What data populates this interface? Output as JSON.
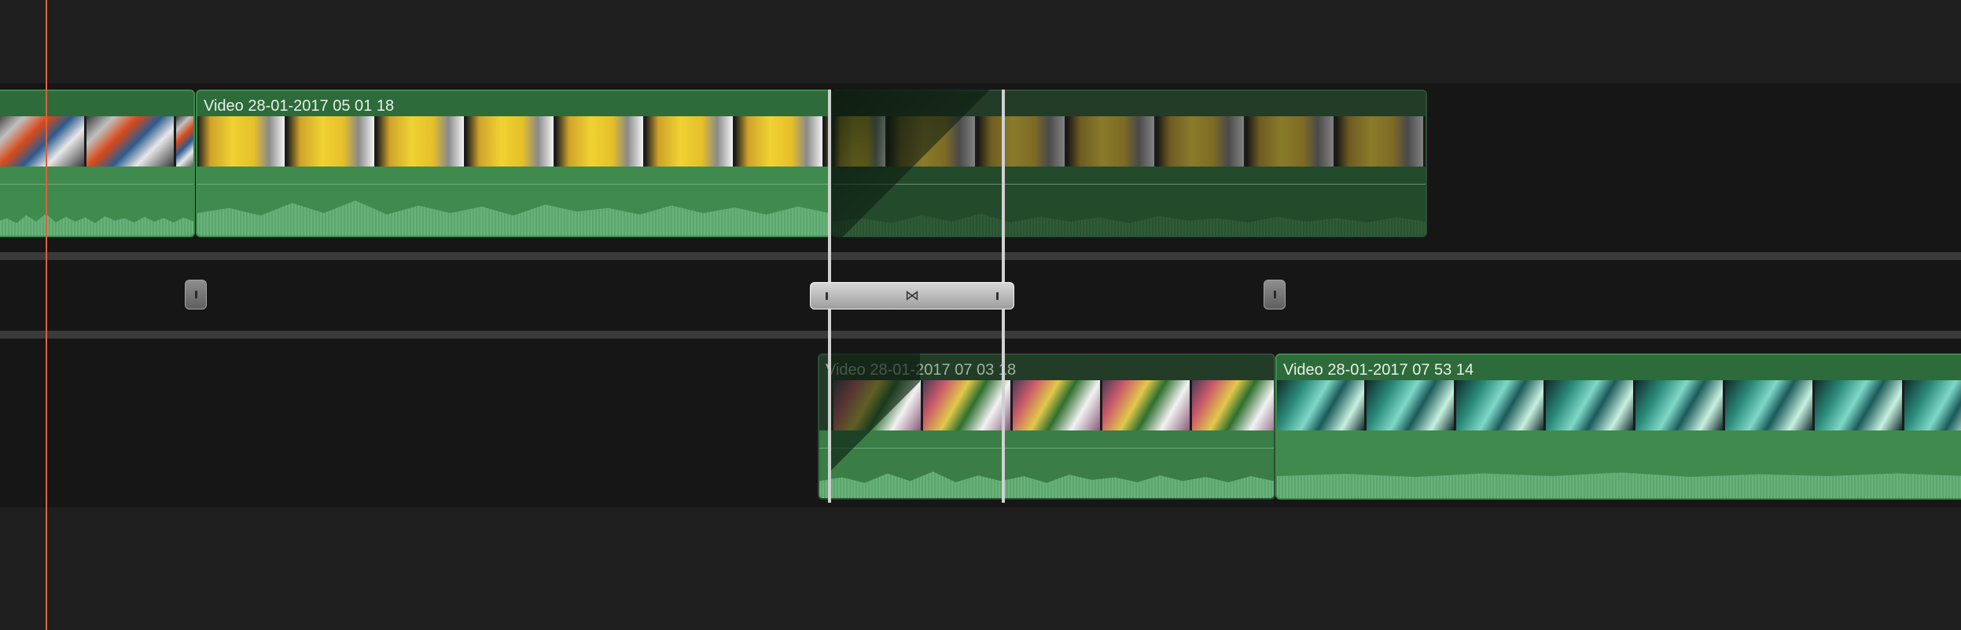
{
  "timeline": {
    "upper_track": {
      "clips": [
        {
          "title": "",
          "thumb_style": "market",
          "thumbs": 2
        },
        {
          "title": "Video 28-01-2017 05 01 18",
          "thumb_style": "sign",
          "thumbs": 7
        },
        {
          "title": "",
          "thumb_style": "sign-dim",
          "thumbs": 5
        }
      ]
    },
    "lower_track": {
      "clips": [
        {
          "title": "Video 28-01-2017 07 03 18",
          "thumb_style": "flower",
          "thumbs": 5
        },
        {
          "title": "Video 28-01-2017 07 53 14",
          "thumb_style": "teal",
          "thumbs": 10
        }
      ]
    },
    "transition": {
      "icon": "cross-dissolve-icon",
      "symbol": "⋈"
    },
    "colors": {
      "clip_green": "#2d6b3a",
      "audio_green": "#3f8a4d",
      "playhead": "#e0603a",
      "background": "#1e1e1f"
    }
  }
}
